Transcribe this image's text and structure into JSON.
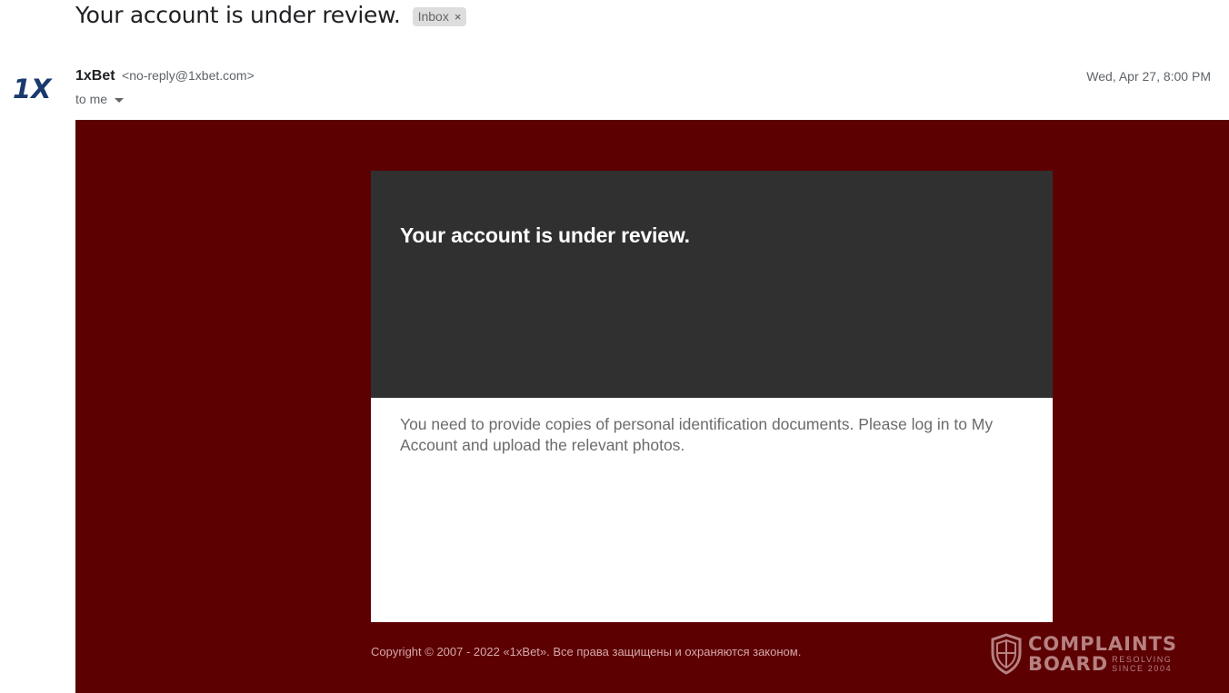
{
  "subject": "Your account is under review.",
  "label": {
    "text": "Inbox",
    "remove": "×"
  },
  "sender": {
    "name": "1xBet",
    "email": "<no-reply@1xbet.com>",
    "logo_text": "1X"
  },
  "recipient": "to me",
  "date": "Wed, Apr 27, 8:00 PM",
  "email": {
    "heading": "Your account is under review.",
    "message": "You need to provide copies of personal identification documents. Please log in to My Account and upload the relevant photos.",
    "copyright": "Copyright © 2007 - 2022 «1xBet». Все права защищены и охраняются законом."
  },
  "watermark": {
    "line1": "COMPLAINTS",
    "line2": "BOARD",
    "tag1": "RESOLVING",
    "tag2": "SINCE 2004"
  },
  "colors": {
    "email_background": "#5c0002",
    "header_panel": "#303030",
    "logo_blue": "#1a3a6e"
  }
}
